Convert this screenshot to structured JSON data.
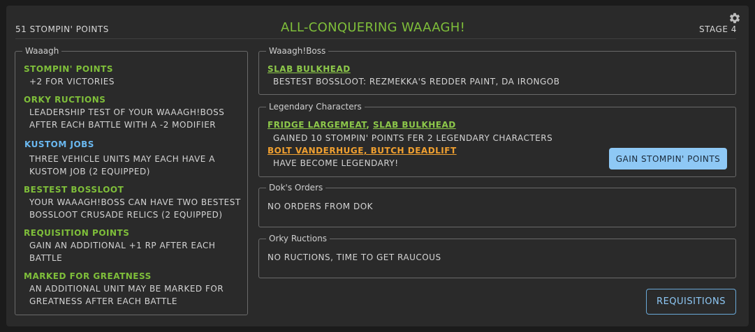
{
  "header": {
    "score": "51 STOMPIN' POINTS",
    "title": "ALL-CONQUERING WAAAGH!",
    "stage": "STAGE 4",
    "settings_icon": "gear-icon"
  },
  "waaagh_panel": {
    "legend": "Waaagh",
    "sections": [
      {
        "heading": "STOMPIN' POINTS",
        "lines": [
          "+2 FOR VICTORIES"
        ]
      },
      {
        "heading": "ORKY RUCTIONS",
        "lines": [
          "LEADERSHIP TEST OF YOUR WAAAGH!BOSS",
          "AFTER EACH BATTLE WITH A -2 MODIFIER"
        ]
      },
      {
        "heading": "KUSTOM JOBS",
        "lines": [
          "THREE VEHICLE UNITS MAY EACH HAVE A",
          "KUSTOM JOB (2 EQUIPPED)"
        ]
      },
      {
        "heading": "BESTEST BOSSLOOT",
        "lines": [
          "YOUR WAAAGH!BOSS CAN HAVE TWO BESTEST",
          "BOSSLOOT CRUSADE RELICS (2 EQUIPPED)"
        ]
      },
      {
        "heading": "REQUISITION POINTS",
        "lines": [
          "GAIN AN ADDITIONAL +1 RP AFTER EACH",
          "BATTLE"
        ]
      },
      {
        "heading": "MARKED FOR GREATNESS",
        "lines": [
          "AN ADDITIONAL UNIT MAY BE MARKED FOR",
          "GREATNESS AFTER EACH BATTLE"
        ]
      }
    ]
  },
  "boss_panel": {
    "legend": "Waaagh!Boss",
    "boss_name": "SLAB BULKHEAD",
    "bossloot": "BESTEST BOSSLOOT: REZMEKKA'S REDDER PAINT, DA IRONGOB"
  },
  "legendary_panel": {
    "legend": "Legendary Characters",
    "group1_names": [
      "FRIDGE LARGEMEAT",
      "SLAB BULKHEAD"
    ],
    "group1_separator": ", ",
    "group1_text": "GAINED 10 STOMPIN' POINTS FER 2 LEGENDARY CHARACTERS",
    "group2_names": "BOLT VANDERHUGE, BUTCH DEADLIFT",
    "group2_text": "HAVE BECOME LEGENDARY!",
    "button": "GAIN STOMPIN' POINTS"
  },
  "doks_panel": {
    "legend": "Dok's Orders",
    "text": "NO ORDERS FROM DOK"
  },
  "ructions_panel": {
    "legend": "Orky Ructions",
    "text": "NO RUCTIONS, TIME TO GET RAUCOUS"
  },
  "requisitions_button": "REQUISITIONS",
  "colors": {
    "accent_green": "#7fbf3a",
    "accent_blue": "#6ab8f0",
    "accent_orange": "#f0a030",
    "button_blue": "#8ec8f5"
  }
}
